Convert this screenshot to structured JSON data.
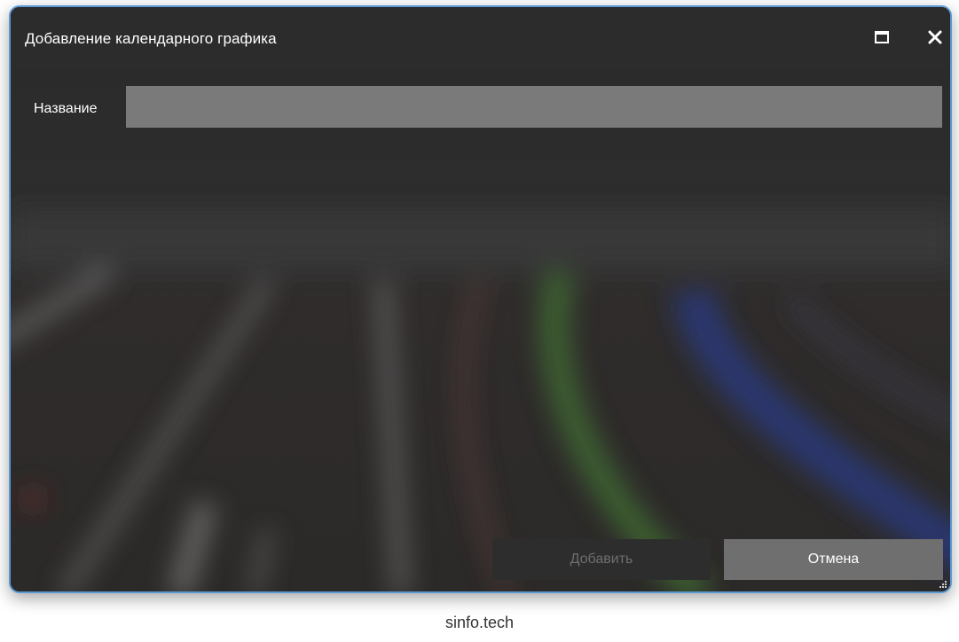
{
  "window": {
    "title": "Добавление календарного графика",
    "accent_border": "#5b9bd5",
    "maximize_icon": "maximize-icon",
    "close_icon": "close-icon"
  },
  "form": {
    "name_label": "Название",
    "name_value": "",
    "name_placeholder": ""
  },
  "buttons": {
    "add_label": "Добавить",
    "add_enabled": false,
    "cancel_label": "Отмена"
  },
  "footer": {
    "watermark": "sinfo.tech"
  }
}
